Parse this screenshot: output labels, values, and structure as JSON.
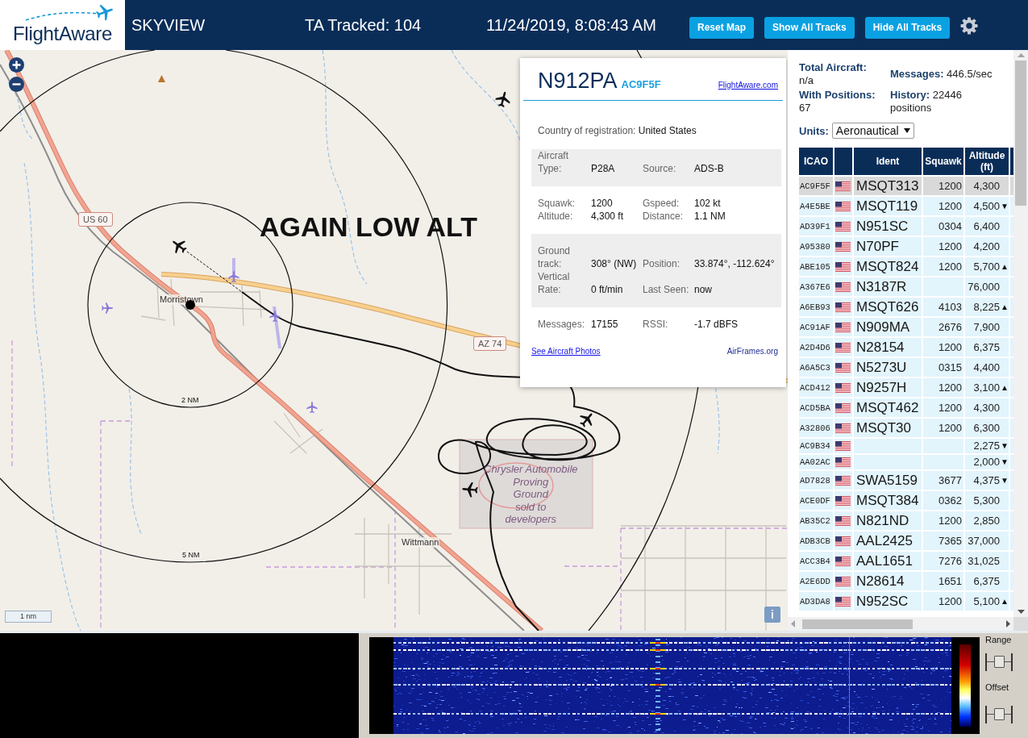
{
  "header": {
    "logo": "FlightAware",
    "title": "SKYVIEW",
    "tracked": "TA Tracked: 104",
    "datetime": "11/24/2019, 8:08:43 AM",
    "buttons": [
      "Reset Map",
      "Show All Tracks",
      "Hide All Tracks"
    ]
  },
  "map": {
    "annotation": "AGAIN LOW ALT",
    "road_labels": [
      "US 60",
      "AZ 74"
    ],
    "place_labels": [
      "Morristown",
      "Wittmann"
    ],
    "area_label": [
      "Chrysler Automobile",
      "Proving",
      "Ground",
      "sold to",
      "developers"
    ],
    "range_rings": [
      {
        "label": "2 NM"
      },
      {
        "label": "5 NM"
      }
    ],
    "scale_label": "1 nm",
    "info_button": "i",
    "aircraft_markers": [
      {
        "color": "#111111"
      },
      {
        "color": "#111111"
      },
      {
        "color": "#111111"
      },
      {
        "color": "#111111"
      },
      {
        "color": "#8878d8"
      },
      {
        "color": "#8878d8"
      },
      {
        "color": "#8878d8"
      },
      {
        "color": "#8878d8"
      }
    ]
  },
  "aircraft_popup": {
    "ident": "N912PA",
    "icao": "AC9F5F",
    "link": "FlightAware.com",
    "country_label": "Country of registration:",
    "country": "United States",
    "sections": [
      [
        {
          "label": "Aircraft Type:",
          "value": "P28A"
        },
        {
          "label": "Source:",
          "value": "ADS-B"
        }
      ],
      [
        {
          "label": "Squawk:",
          "value": "1200"
        },
        {
          "label": "Gspeed:",
          "value": "102 kt"
        },
        {
          "label": "Altitude:",
          "value": "4,300 ft"
        },
        {
          "label": "Distance:",
          "value": "1.1 NM"
        }
      ],
      [
        {
          "label": "Ground track:",
          "value": "308° (NW)"
        },
        {
          "label": "Position:",
          "value": "33.874°, -112.624°"
        },
        {
          "label": "Vertical Rate:",
          "value": "0 ft/min"
        },
        {
          "label": "Last Seen:",
          "value": "now"
        }
      ],
      [
        {
          "label": "Messages:",
          "value": "17155"
        },
        {
          "label": "RSSI:",
          "value": "-1.7 dBFS"
        }
      ]
    ],
    "links": [
      "See Aircraft Photos",
      "AirFrames.org"
    ]
  },
  "stats": [
    "**Total Aircraft:** n/a",
    "**Messages:** 446.5/sec",
    "**With Positions:** 67",
    "**History:** 22446 positions"
  ],
  "units": {
    "label": "Units:",
    "value": "Aeronautical"
  },
  "table": {
    "columns": [
      "ICAO",
      "Ident",
      "Squawk",
      "Altitude (ft)"
    ],
    "rows": [
      {
        "icao": "AC9F5F",
        "ident": "MSQT313",
        "squawk": "1200",
        "altitude": "4,300",
        "selected": true
      },
      {
        "icao": "A4E5BE",
        "ident": "MSQT119",
        "squawk": "1200",
        "altitude": "4,500",
        "trend": "▼",
        "selected": false
      },
      {
        "icao": "AD39F1",
        "ident": "N951SC",
        "squawk": "0304",
        "altitude": "6,400",
        "selected": false
      },
      {
        "icao": "A95380",
        "ident": "N70PF",
        "squawk": "1200",
        "altitude": "4,200",
        "selected": false
      },
      {
        "icao": "ABE105",
        "ident": "MSQT824",
        "squawk": "1200",
        "altitude": "5,700",
        "trend": "▲",
        "selected": false
      },
      {
        "icao": "A367E6",
        "ident": "N3187R",
        "altitude": "76,000",
        "selected": false
      },
      {
        "icao": "A6EB93",
        "ident": "MSQT626",
        "squawk": "4103",
        "altitude": "8,225",
        "trend": "▲",
        "selected": false
      },
      {
        "icao": "AC91AF",
        "ident": "N909MA",
        "squawk": "2676",
        "altitude": "7,900",
        "selected": false
      },
      {
        "icao": "A2D4D6",
        "ident": "N28154",
        "squawk": "1200",
        "altitude": "6,375",
        "selected": false
      },
      {
        "icao": "A6A5C3",
        "ident": "N5273U",
        "squawk": "0315",
        "altitude": "4,400",
        "selected": false
      },
      {
        "icao": "ACD412",
        "ident": "N9257H",
        "squawk": "1200",
        "altitude": "3,100",
        "trend": "▲",
        "selected": false
      },
      {
        "icao": "ACD5BA",
        "ident": "MSQT462",
        "squawk": "1200",
        "altitude": "4,300",
        "selected": false
      },
      {
        "icao": "A32806",
        "ident": "MSQT30",
        "squawk": "1200",
        "altitude": "6,300",
        "selected": false
      },
      {
        "icao": "AC9B34",
        "altitude": "2,275",
        "trend": "▼",
        "selected": false
      },
      {
        "icao": "AA02AC",
        "altitude": "2,000",
        "trend": "▼",
        "selected": false
      },
      {
        "icao": "AD7828",
        "ident": "SWA5159",
        "squawk": "3677",
        "altitude": "4,375",
        "trend": "▼",
        "selected": false
      },
      {
        "icao": "ACE0DF",
        "ident": "MSQT384",
        "squawk": "0362",
        "altitude": "5,300",
        "selected": false
      },
      {
        "icao": "AB35C2",
        "ident": "N821ND",
        "squawk": "1200",
        "altitude": "2,850",
        "selected": false
      },
      {
        "icao": "ADB3CB",
        "ident": "AAL2425",
        "squawk": "7365",
        "altitude": "37,000",
        "selected": false
      },
      {
        "icao": "ACC3B4",
        "ident": "AAL1651",
        "squawk": "7276",
        "altitude": "31,025",
        "selected": false
      },
      {
        "icao": "A2E6DD",
        "ident": "N28614",
        "squawk": "1651",
        "altitude": "6,375",
        "selected": false
      },
      {
        "icao": "AD3DA8",
        "ident": "N952SC",
        "squawk": "1200",
        "altitude": "5,100",
        "trend": "▲",
        "selected": false
      }
    ]
  },
  "spectrum": {
    "controls": [
      {
        "label": "Range",
        "level": 0.5
      },
      {
        "label": "Offset",
        "level": 0.5
      }
    ]
  }
}
